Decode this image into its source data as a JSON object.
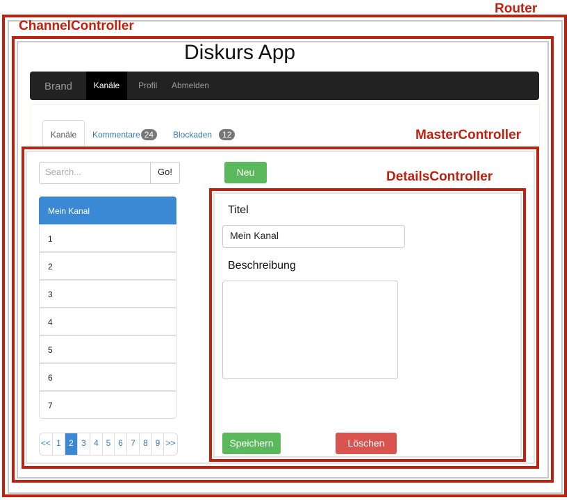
{
  "labels": {
    "router": "Router",
    "channel_controller": "ChannelController",
    "master_controller": "MasterController",
    "details_controller": "DetailsController"
  },
  "app": {
    "title": "Diskurs App"
  },
  "navbar": {
    "brand": "Brand",
    "items": [
      "Kanäle",
      "Profil",
      "Abmelden"
    ],
    "active_index": 0
  },
  "tabs": [
    {
      "label": "Kanäle",
      "active": true
    },
    {
      "label": "Kommentare",
      "badge": "24"
    },
    {
      "label": "Blockaden",
      "badge": "12"
    }
  ],
  "search": {
    "placeholder": "Search...",
    "button": "Go!"
  },
  "buttons": {
    "new": "Neu",
    "save": "Speichern",
    "delete": "Löschen"
  },
  "channels": {
    "items": [
      "Mein Kanal",
      "1",
      "2",
      "3",
      "4",
      "5",
      "6",
      "7"
    ],
    "active_index": 0
  },
  "pagination": {
    "items": [
      "<<",
      "1",
      "2",
      "3",
      "4",
      "5",
      "6",
      "7",
      "8",
      "9",
      ">>"
    ],
    "active": "2"
  },
  "details": {
    "title_label": "Titel",
    "title_value": "Mein Kanal",
    "description_label": "Beschreibung",
    "description_value": ""
  },
  "colors": {
    "frame_red": "#c0210f",
    "navbar_bg": "#222222",
    "active_blue": "#3b89d4",
    "success_green": "#5cb85c",
    "danger_red": "#d9534f"
  }
}
